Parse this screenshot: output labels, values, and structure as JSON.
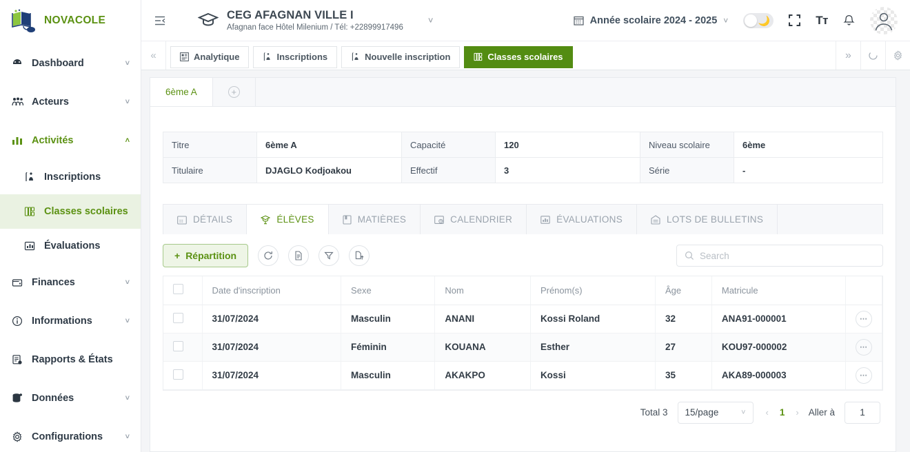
{
  "brand": {
    "name": "NOVACOLE"
  },
  "sidebar": {
    "items": [
      {
        "label": "Dashboard",
        "icon": "dashboard-icon",
        "expandable": true,
        "open": false
      },
      {
        "label": "Acteurs",
        "icon": "users-icon",
        "expandable": true,
        "open": false
      },
      {
        "label": "Activités",
        "icon": "chart-bar-icon",
        "expandable": true,
        "open": true
      },
      {
        "label": "Finances",
        "icon": "wallet-icon",
        "expandable": true,
        "open": false
      },
      {
        "label": "Informations",
        "icon": "info-circle-icon",
        "expandable": true,
        "open": false
      },
      {
        "label": "Rapports & États",
        "icon": "report-icon",
        "expandable": false,
        "open": false
      },
      {
        "label": "Données",
        "icon": "database-icon",
        "expandable": true,
        "open": false
      },
      {
        "label": "Configurations",
        "icon": "gear-icon",
        "expandable": true,
        "open": false
      }
    ],
    "sub_items": [
      {
        "label": "Inscriptions",
        "icon": "enrollment-icon",
        "active": false
      },
      {
        "label": "Classes scolaires",
        "icon": "classroom-icon",
        "active": true
      },
      {
        "label": "Évaluations",
        "icon": "evaluation-icon",
        "active": false
      }
    ]
  },
  "topbar": {
    "collapse_icon": "sidebar-collapse-icon",
    "school_icon": "graduation-cap-icon",
    "school_name": "CEG AFAGNAN VILLE I",
    "school_sub": "Afagnan face Hôtel Milenium / Tél: +22899917496",
    "school_chevron": "chevron-down-icon",
    "calendar_icon": "calendar-icon",
    "school_year": "Année scolaire 2024 - 2025",
    "year_chevron": "chevron-down-icon",
    "theme_toggle_icon": "moon-icon",
    "fullscreen_icon": "fullscreen-icon",
    "text_size_label": "Tт",
    "bell_icon": "bell-icon",
    "avatar_icon": "user-avatar-icon"
  },
  "modbar": {
    "back_icon": "double-chevron-left-icon",
    "forward_icon": "double-chevron-right-icon",
    "refresh_icon": "refresh-icon",
    "settings_icon": "gear-icon",
    "tabs": [
      {
        "label": "Analytique",
        "icon": "analytics-icon",
        "active": false
      },
      {
        "label": "Inscriptions",
        "icon": "enrollment-icon",
        "active": false
      },
      {
        "label": "Nouvelle inscription",
        "icon": "enrollment-icon",
        "active": false
      },
      {
        "label": "Classes scolaires",
        "icon": "classroom-icon",
        "active": true
      }
    ]
  },
  "class_tabs": {
    "items": [
      {
        "label": "6ème A",
        "active": true
      }
    ],
    "add_label": "+"
  },
  "info_table": {
    "rows": [
      {
        "label1": "Titre",
        "value1": "6ème A",
        "label2": "Capacité",
        "value2": "120",
        "label3": "Niveau scolaire",
        "value3": "6ème"
      },
      {
        "label1": "Titulaire",
        "value1": "DJAGLO Kodjoakou",
        "label2": "Effectif",
        "value2": "3",
        "label3": "Série",
        "value3": "-"
      }
    ]
  },
  "detail_tabs": [
    {
      "label": "DÉTAILS",
      "icon": "details-icon",
      "active": false
    },
    {
      "label": "ÉLÈVES",
      "icon": "student-icon",
      "active": true
    },
    {
      "label": "MATIÈRES",
      "icon": "book-icon",
      "active": false
    },
    {
      "label": "CALENDRIER",
      "icon": "calendar-clock-icon",
      "active": false
    },
    {
      "label": "ÉVALUATIONS",
      "icon": "evaluation-icon",
      "active": false
    },
    {
      "label": "LOTS DE BULLETINS",
      "icon": "bulletin-icon",
      "active": false
    }
  ],
  "toolbar": {
    "repartition_label": "Répartition",
    "repartition_plus": "+",
    "refresh_icon": "refresh-icon",
    "document_icon": "document-icon",
    "filter_icon": "filter-icon",
    "export_icon": "export-icon"
  },
  "search": {
    "placeholder": "Search",
    "value": "",
    "icon": "search-icon"
  },
  "table": {
    "columns": [
      "Date d'inscription",
      "Sexe",
      "Nom",
      "Prénom(s)",
      "Âge",
      "Matricule"
    ],
    "rows": [
      {
        "date": "31/07/2024",
        "sexe": "Masculin",
        "nom": "ANANI",
        "prenom": "Kossi Roland",
        "age": "32",
        "matricule": "ANA91-000001"
      },
      {
        "date": "31/07/2024",
        "sexe": "Féminin",
        "nom": "KOUANA",
        "prenom": "Esther",
        "age": "27",
        "matricule": "KOU97-000002"
      },
      {
        "date": "31/07/2024",
        "sexe": "Masculin",
        "nom": "AKAKPO",
        "prenom": "Kossi",
        "age": "35",
        "matricule": "AKA89-000003"
      }
    ],
    "row_action_icon": "ellipsis-icon"
  },
  "pagination": {
    "total_label": "Total 3",
    "page_size": "15/page",
    "prev_icon": "chevron-left-icon",
    "next_icon": "chevron-right-icon",
    "current_page": "1",
    "goto_label": "Aller à",
    "goto_value": "1"
  },
  "colors": {
    "accent_green": "#5b9112",
    "tab_green": "#538c12",
    "active_bg": "#eaf2e2",
    "page_bg": "#f4f5f7"
  }
}
